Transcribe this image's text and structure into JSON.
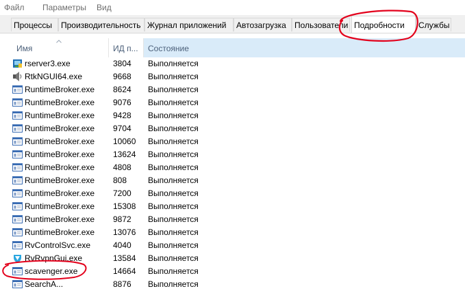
{
  "menu": {
    "file": "Файл",
    "options": "Параметры",
    "view": "Вид"
  },
  "tabs": [
    {
      "label": "Процессы"
    },
    {
      "label": "Производительность"
    },
    {
      "label": "Журнал приложений"
    },
    {
      "label": "Автозагрузка"
    },
    {
      "label": "Пользователи"
    },
    {
      "label": "Подробности",
      "active": true
    },
    {
      "label": "Службы"
    }
  ],
  "columns": {
    "name": "Имя",
    "pid": "ИД п...",
    "status": "Состояние"
  },
  "rows": [
    {
      "name": "rserver3.exe",
      "pid": "3804",
      "status": "Выполняется",
      "icon": "rserver-icon"
    },
    {
      "name": "RtkNGUI64.exe",
      "pid": "9668",
      "status": "Выполняется",
      "icon": "audio-speaker-icon"
    },
    {
      "name": "RuntimeBroker.exe",
      "pid": "8624",
      "status": "Выполняется",
      "icon": "window-app-icon"
    },
    {
      "name": "RuntimeBroker.exe",
      "pid": "9076",
      "status": "Выполняется",
      "icon": "window-app-icon"
    },
    {
      "name": "RuntimeBroker.exe",
      "pid": "9428",
      "status": "Выполняется",
      "icon": "window-app-icon"
    },
    {
      "name": "RuntimeBroker.exe",
      "pid": "9704",
      "status": "Выполняется",
      "icon": "window-app-icon"
    },
    {
      "name": "RuntimeBroker.exe",
      "pid": "10060",
      "status": "Выполняется",
      "icon": "window-app-icon"
    },
    {
      "name": "RuntimeBroker.exe",
      "pid": "13624",
      "status": "Выполняется",
      "icon": "window-app-icon"
    },
    {
      "name": "RuntimeBroker.exe",
      "pid": "4808",
      "status": "Выполняется",
      "icon": "window-app-icon"
    },
    {
      "name": "RuntimeBroker.exe",
      "pid": "808",
      "status": "Выполняется",
      "icon": "window-app-icon"
    },
    {
      "name": "RuntimeBroker.exe",
      "pid": "7200",
      "status": "Выполняется",
      "icon": "window-app-icon"
    },
    {
      "name": "RuntimeBroker.exe",
      "pid": "15308",
      "status": "Выполняется",
      "icon": "window-app-icon"
    },
    {
      "name": "RuntimeBroker.exe",
      "pid": "9872",
      "status": "Выполняется",
      "icon": "window-app-icon"
    },
    {
      "name": "RuntimeBroker.exe",
      "pid": "13076",
      "status": "Выполняется",
      "icon": "window-app-icon"
    },
    {
      "name": "RvControlSvc.exe",
      "pid": "4040",
      "status": "Выполняется",
      "icon": "window-app-icon"
    },
    {
      "name": "RvRvpnGui.exe",
      "pid": "13584",
      "status": "Выполняется",
      "icon": "shield-icon"
    },
    {
      "name": "scavenger.exe",
      "pid": "14664",
      "status": "Выполняется",
      "icon": "window-app-icon"
    },
    {
      "name": "SearchA...",
      "pid": "8876",
      "status": "Выполняется",
      "icon": "window-app-icon"
    }
  ],
  "colors": {
    "header_text": "#4c607a",
    "status_header_bg": "#d9ebf9",
    "annotation": "#e3001b"
  }
}
